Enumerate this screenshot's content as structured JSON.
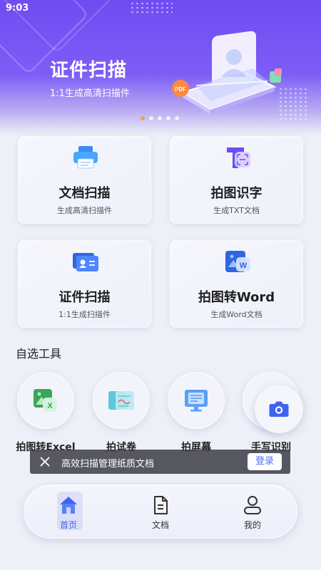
{
  "status_bar": {
    "time": "9:03"
  },
  "banner": {
    "title": "证件扫描",
    "subtitle": "1:1生成高清扫描件",
    "pdf_badge": "PDF",
    "carousel_count": 5,
    "carousel_active_index": 0,
    "colors": {
      "gradient_top": "#6f4cf2",
      "active_dot": "#ff9a4d"
    }
  },
  "features": [
    {
      "title": "文档扫描",
      "subtitle": "生成高清扫描件",
      "icon": "printer-icon"
    },
    {
      "title": "拍图识字",
      "subtitle": "生成TXT文档",
      "icon": "text-recognition-icon"
    },
    {
      "title": "证件扫描",
      "subtitle": "1:1生成扫描件",
      "icon": "id-card-icon"
    },
    {
      "title": "拍图转Word",
      "subtitle": "生成Word文档",
      "icon": "word-doc-icon"
    }
  ],
  "section": {
    "title": "自选工具"
  },
  "tools": [
    {
      "label": "拍图转Excel",
      "icon": "excel-icon"
    },
    {
      "label": "拍试卷",
      "icon": "exam-paper-icon"
    },
    {
      "label": "拍屏幕",
      "icon": "screen-icon"
    },
    {
      "label": "手写识别",
      "icon": "handwriting-icon"
    }
  ],
  "camera_fab": {
    "icon": "camera-icon"
  },
  "login_bar": {
    "text": "高效扫描管理纸质文档",
    "button": "登录"
  },
  "bottom_nav": [
    {
      "label": "首页",
      "icon": "home-icon",
      "active": true
    },
    {
      "label": "文档",
      "icon": "document-icon",
      "active": false
    },
    {
      "label": "我的",
      "icon": "profile-icon",
      "active": false
    }
  ],
  "accent_color": "#3f63f0"
}
